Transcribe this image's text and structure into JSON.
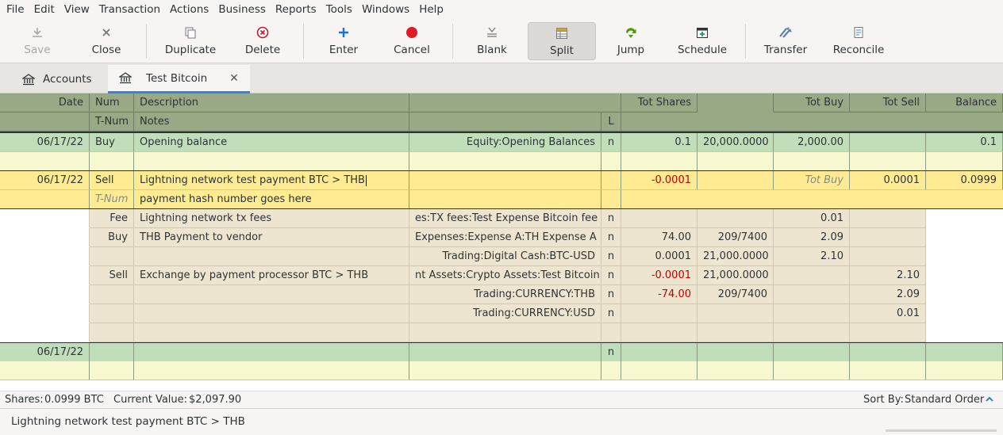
{
  "menu": [
    "File",
    "Edit",
    "View",
    "Transaction",
    "Actions",
    "Business",
    "Reports",
    "Tools",
    "Windows",
    "Help"
  ],
  "toolbar": {
    "save": "Save",
    "close": "Close",
    "duplicate": "Duplicate",
    "delete": "Delete",
    "enter": "Enter",
    "cancel": "Cancel",
    "blank": "Blank",
    "split": "Split",
    "jump": "Jump",
    "schedule": "Schedule",
    "transfer": "Transfer",
    "reconcile": "Reconcile"
  },
  "tabs": {
    "accounts": "Accounts",
    "register": "Test Bitcoin",
    "close_glyph": "✕"
  },
  "header": {
    "date": "Date",
    "num": "Num",
    "description": "Description",
    "tot_shares": "Tot Shares",
    "tot_buy": "Tot Buy",
    "tot_sell": "Tot Sell",
    "balance": "Balance",
    "tnum": "T-Num",
    "notes": "Notes",
    "l": "L"
  },
  "opening": {
    "date": "06/17/22",
    "num": "Buy",
    "description": "Opening balance",
    "transfer": "Equity:Opening Balances",
    "r": "n",
    "shares": "0.1",
    "price": "20,000.0000",
    "buy": "2,000.00",
    "balance": "0.1"
  },
  "current": {
    "date": "06/17/22",
    "num": "Sell",
    "description": "Lightning network test payment BTC > THB",
    "shares": "-0.0001",
    "buy_placeholder": "Tot Buy",
    "sell": "0.0001",
    "balance": "0.0999",
    "tnum_placeholder": "T-Num",
    "notes": "payment hash number goes here"
  },
  "splits": [
    {
      "action": "Fee",
      "memo": "Lightning network tx fees",
      "account": "es:TX fees:Test Expense Bitcoin fee",
      "r": "n",
      "amount": "",
      "price": "",
      "buy": "0.01",
      "sell": ""
    },
    {
      "action": "Buy",
      "memo": "THB Payment to vendor",
      "account": "Expenses:Expense A:TH Expense A",
      "r": "n",
      "amount": "74.00",
      "price": "209/7400",
      "buy": "2.09",
      "sell": ""
    },
    {
      "action": "",
      "memo": "",
      "account": "Trading:Digital Cash:BTC-USD",
      "r": "n",
      "amount": "0.0001",
      "price": "21,000.0000",
      "buy": "2.10",
      "sell": ""
    },
    {
      "action": "Sell",
      "memo": "Exchange by payment processor BTC > THB",
      "account": "nt Assets:Crypto Assets:Test Bitcoin",
      "r": "n",
      "amount": "-0.0001",
      "price": "21,000.0000",
      "buy": "",
      "sell": "2.10"
    },
    {
      "action": "",
      "memo": "",
      "account": "Trading:CURRENCY:THB",
      "r": "n",
      "amount": "-74.00",
      "price": "209/7400",
      "buy": "",
      "sell": "2.09"
    },
    {
      "action": "",
      "memo": "",
      "account": "Trading:CURRENCY:USD",
      "r": "n",
      "amount": "",
      "price": "",
      "buy": "",
      "sell": "0.01"
    }
  ],
  "blank": {
    "date": "06/17/22",
    "r": "n"
  },
  "summary": {
    "shares_label": "Shares:",
    "shares": "0.0999 BTC",
    "value_label": "Current Value:",
    "value": "$2,097.90",
    "sort_label": "Sort By:",
    "sort": "Standard Order"
  },
  "status": "Lightning network test payment BTC > THB"
}
